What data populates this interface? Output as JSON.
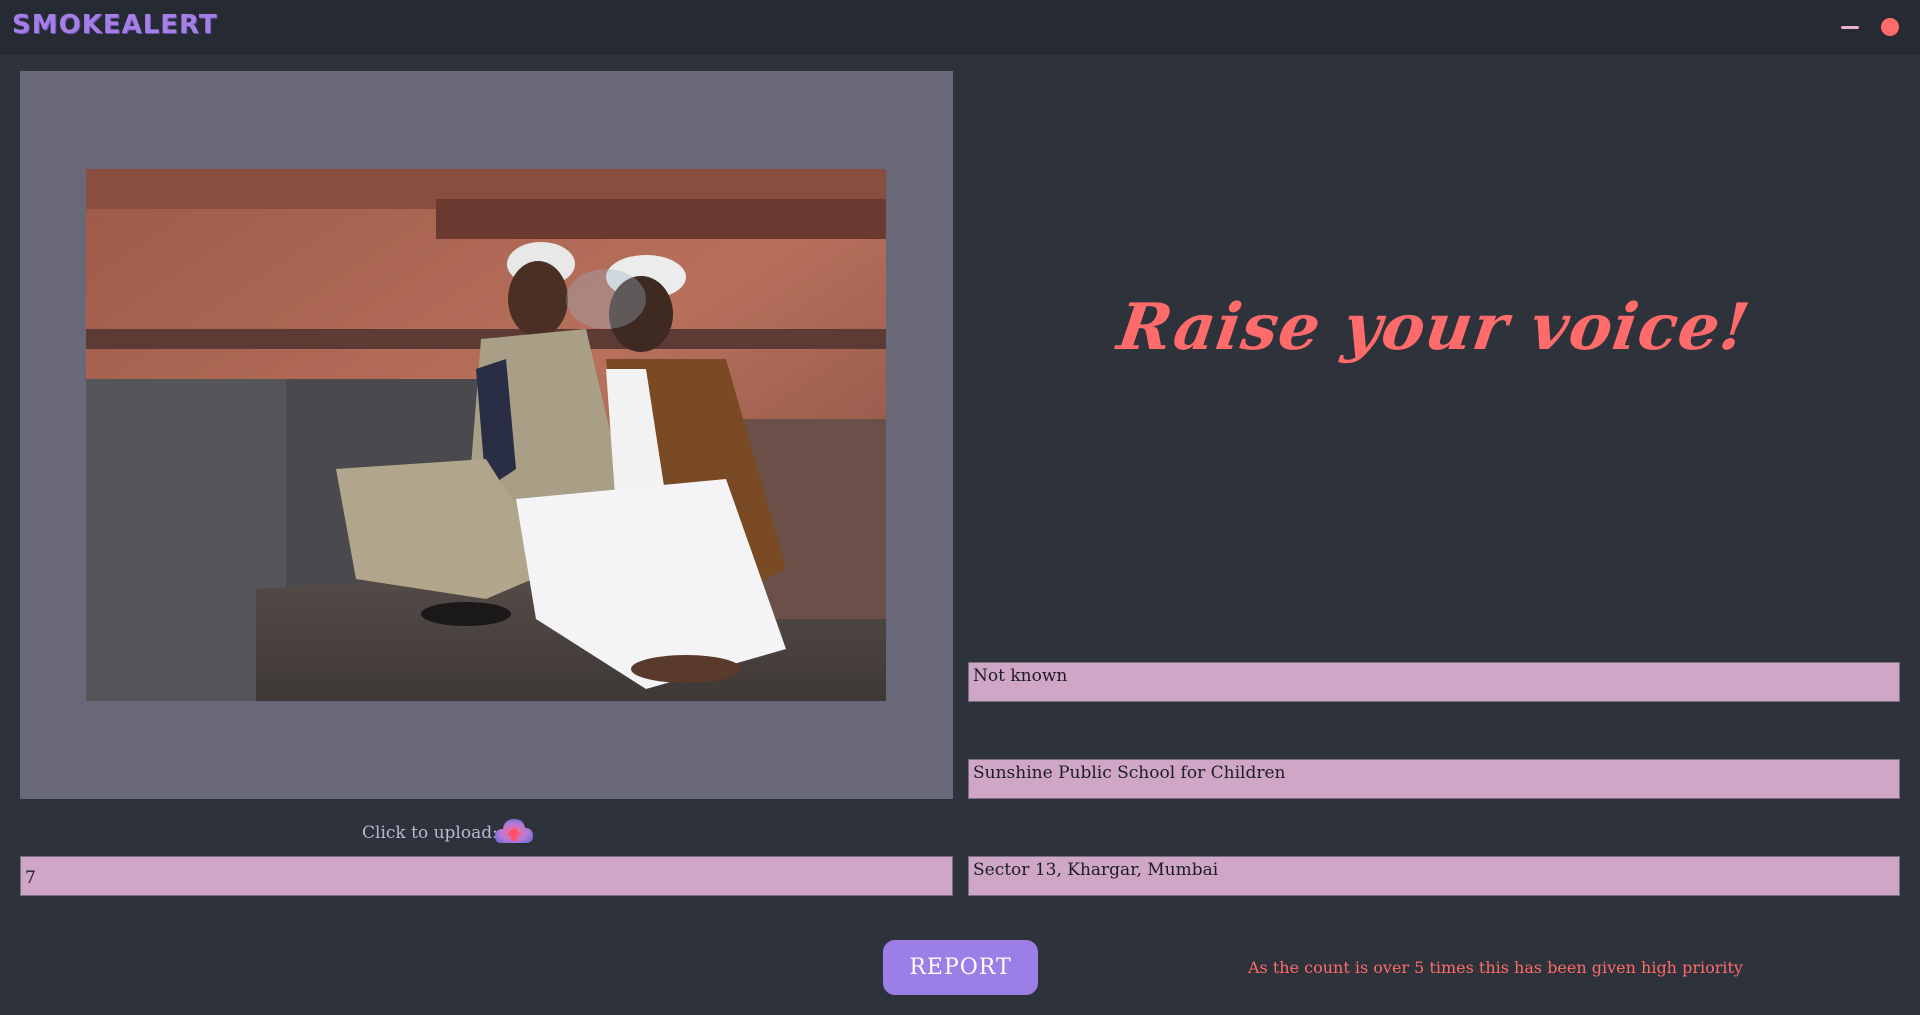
{
  "app": {
    "title": "SMOKEALERT"
  },
  "upload": {
    "label": "Click to upload:"
  },
  "report": {
    "count": "7",
    "headline": "Raise your voice!",
    "fields": [
      "Not known",
      "Sunshine Public School for Children",
      "Sector 13, Khargar, Mumbai"
    ],
    "button_label": "REPORT",
    "priority_message": "As the count is over 5 times this has been given high priority"
  },
  "colors": {
    "background": "#2d323b",
    "titlebar": "#262a33",
    "accent_purple": "#9b7fe6",
    "accent_red": "#ff6b6b",
    "field_pink": "#cfa6c6"
  },
  "icons": {
    "minimize": "minimize-icon",
    "close": "close-icon",
    "upload": "upload-cloud-icon"
  }
}
